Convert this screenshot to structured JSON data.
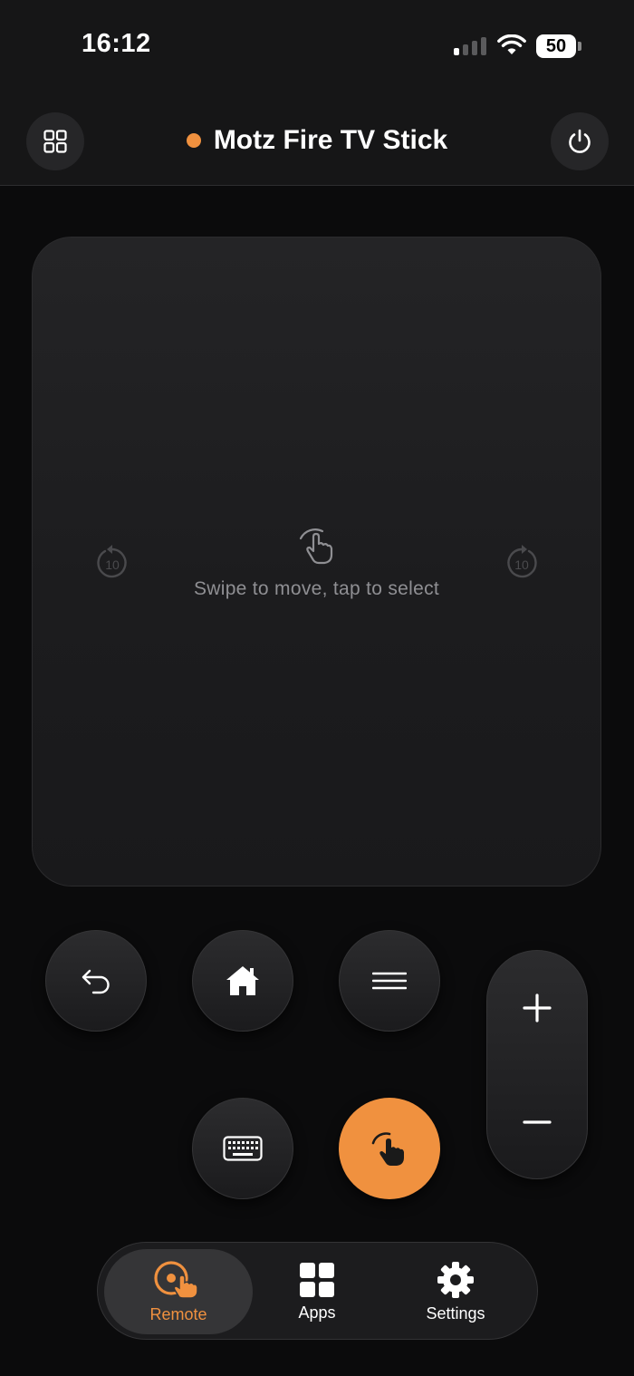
{
  "status_bar": {
    "time": "16:12",
    "battery": "50"
  },
  "header": {
    "title": "Motz Fire TV Stick",
    "status_color": "#f0913f",
    "left_icon": "grid-icon",
    "right_icon": "power-icon"
  },
  "touchpad": {
    "hint": "Swipe to move, tap to select",
    "skip_back_label": "10",
    "skip_forward_label": "10"
  },
  "controls": {
    "back_icon": "back-arrow-icon",
    "home_icon": "home-icon",
    "menu_icon": "menu-icon",
    "keyboard_icon": "keyboard-icon",
    "select_icon": "tap-hand-icon",
    "volume_up_icon": "plus-icon",
    "volume_down_icon": "minus-icon"
  },
  "tabs": [
    {
      "label": "Remote",
      "icon": "remote-icon",
      "active": true
    },
    {
      "label": "Apps",
      "icon": "apps-grid-icon",
      "active": false
    },
    {
      "label": "Settings",
      "icon": "gear-icon",
      "active": false
    }
  ],
  "colors": {
    "accent": "#f0913f",
    "background": "#0b0b0c",
    "surface": "#1c1c1e"
  }
}
